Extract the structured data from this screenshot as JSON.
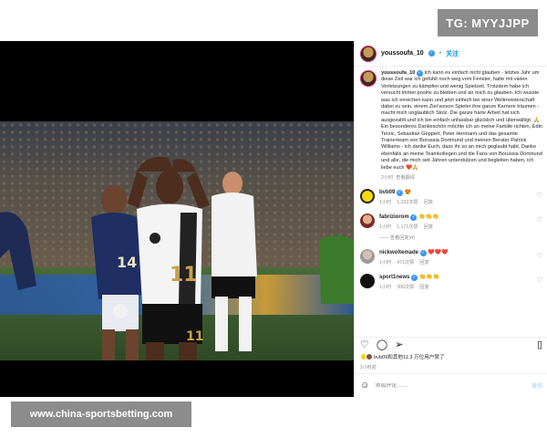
{
  "watermarks": {
    "top_right": "TG: MYYJJPP",
    "bottom_left": "www.china-sportsbetting.com"
  },
  "post": {
    "username": "youssoufa_10",
    "follow_label": "关注",
    "jersey_number": "11",
    "caption": "Ich kann es einfach nicht glauben - letztes Jahr um diese Zeit war ich gefühlt noch weg vom Fenster, hatte mit vielen Verletzungen zu kämpfen und wenig Spielzeit. Trotzdem habe ich versucht immer positiv zu bleiben und an mich zu glauben. Ich wusste was ich erreichen kann und jetzt einfach bei einer Weltmeisterschaft dabei zu sein, einem Ziel wovon Spieler ihre ganze Karriere träumen - macht mich unglaublich Stolz. Die ganze harte Arbeit hat sich ausgezahlt und ich bin einfach unfassbar glücklich und überwältigt. 🙏\nEin besonderes Dankeschön möchte ich an meine Familie richten, Edin Terzic, Sebastian Geppert, Peter Hermann und das gesamte Trainerteam von Borussia Dortmund und meinen Berater Patrick Williams - ich danke Euch, dass ihr so an mich geglaubt habt. Danke ebenfalls an meine Teamkollegen und die Fans von Borussia Dortmund und alle, die mich seit Jahren unterstützen und begleiten haben, ich liebe euch ❤️🙏",
    "caption_time": "2小时",
    "translate_label": "查看翻译",
    "likes_text": "bvb09和其他11.3 万位用户赞了",
    "post_time": "2小时前",
    "comment_placeholder": "添加评论……",
    "post_button": "发布"
  },
  "comments": [
    {
      "user": "bvb09",
      "text": "😍",
      "time": "1小时",
      "likes": "1,232次赞",
      "reply": "回复",
      "replies": "",
      "avatar_color": "#f5d90a"
    },
    {
      "user": "fabriziorom",
      "text": "👏👏👏",
      "time": "1小时",
      "likes": "1,171次赞",
      "reply": "回复",
      "replies": "—— 查看回复(4)",
      "avatar_color": "#7a2a2a"
    },
    {
      "user": "nickwoltemade",
      "text": "❤️❤️❤️",
      "time": "1小时",
      "likes": "471次赞",
      "reply": "回复",
      "replies": "",
      "avatar_color": "#b8b8b8"
    },
    {
      "user": "sport1news",
      "text": "👏👏👏",
      "time": "1小时",
      "likes": "306次赞",
      "reply": "回复",
      "replies": "",
      "avatar_color": "#111111"
    }
  ],
  "colors": {
    "accent_blue": "#0095f6",
    "verified_blue": "#3897f0",
    "muted_text": "#8e8e8e"
  },
  "icons": [
    "heart-icon",
    "comment-icon",
    "share-icon",
    "bookmark-icon",
    "emoji-icon",
    "verified-icon"
  ]
}
